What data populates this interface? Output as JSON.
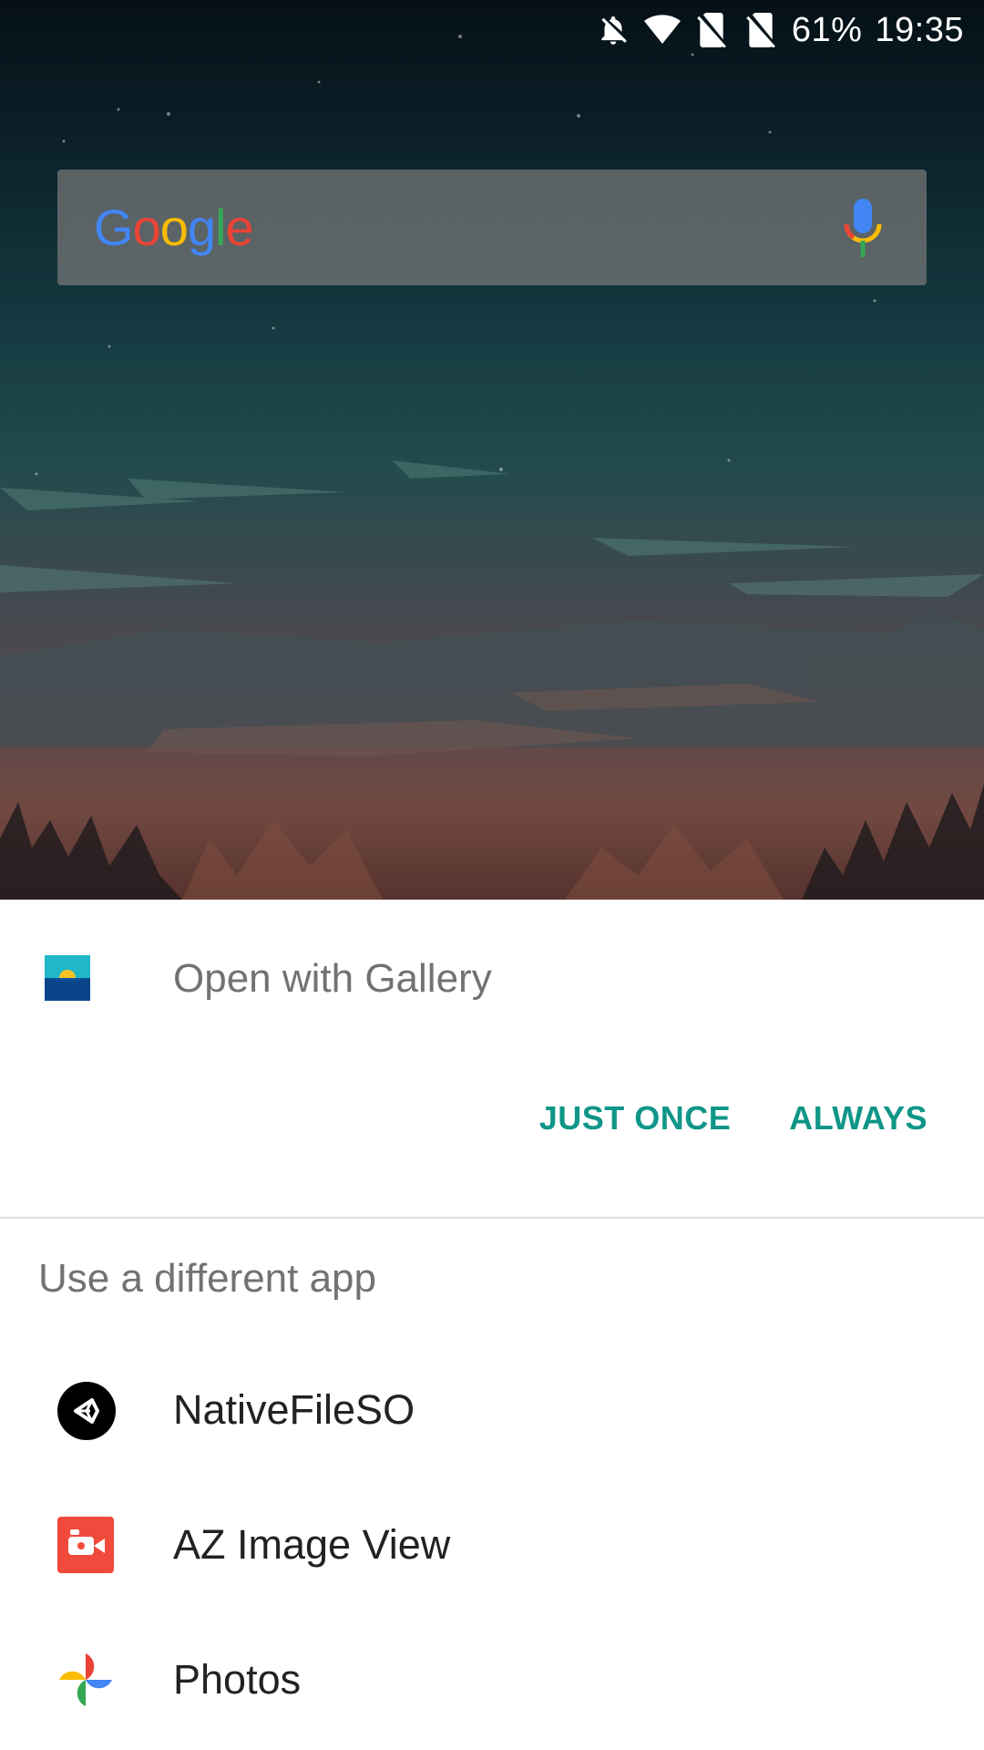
{
  "status_bar": {
    "battery": "61%",
    "time": "19:35",
    "icons": [
      "notifications-off-icon",
      "wifi-icon",
      "no-sim-icon",
      "no-sim-icon"
    ]
  },
  "search_bar": {
    "logo_text": "Google",
    "logo_letters": [
      {
        "char": "G",
        "color": "#4285F4"
      },
      {
        "char": "o",
        "color": "#EA4335"
      },
      {
        "char": "o",
        "color": "#FBBC05"
      },
      {
        "char": "g",
        "color": "#4285F4"
      },
      {
        "char": "l",
        "color": "#34A853"
      },
      {
        "char": "e",
        "color": "#EA4335"
      }
    ],
    "mic_icon": "mic-icon"
  },
  "sheet": {
    "open_with_label": "Open with Gallery",
    "just_once_label": "JUST ONCE",
    "always_label": "ALWAYS",
    "section_title": "Use a different app",
    "apps": [
      {
        "label": "NativeFileSO",
        "icon": "unity-icon"
      },
      {
        "label": "AZ Image View",
        "icon": "video-camera-icon"
      },
      {
        "label": "Photos",
        "icon": "photos-pinwheel-icon"
      }
    ]
  },
  "colors": {
    "accent": "#0F9688",
    "primary_text": "#222222",
    "secondary_text": "#727272"
  }
}
